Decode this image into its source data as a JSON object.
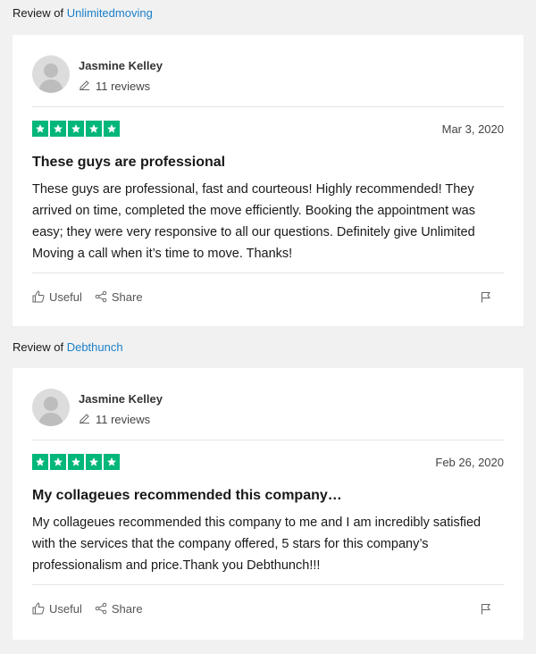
{
  "reviews": [
    {
      "review_of_label": "Review of",
      "company": "Unlimitedmoving",
      "user_name": "Jasmine Kelley",
      "review_count": "11 reviews",
      "rating": 5,
      "date": "Mar 3, 2020",
      "title": "These guys are professional",
      "body": "These guys are professional, fast and courteous! Highly recommended! They arrived on time, completed the move efficiently. Booking the appointment was easy; they were very responsive to all our questions. Definitely give Unlimited Moving a call when it’s time to move. Thanks!",
      "useful_label": "Useful",
      "share_label": "Share"
    },
    {
      "review_of_label": "Review of",
      "company": "Debthunch",
      "user_name": "Jasmine Kelley",
      "review_count": "11 reviews",
      "rating": 5,
      "date": "Feb 26, 2020",
      "title": "My collageues recommended this company…",
      "body": "My collageues recommended this company to me and I am incredibly satisfied with the services that the company offered, 5 stars for this company’s professionalism and price.Thank you Debthunch!!!",
      "useful_label": "Useful",
      "share_label": "Share"
    }
  ],
  "colors": {
    "star_green": "#00b67a",
    "link_blue": "#1c80c8",
    "page_bg": "#f1f1f2"
  },
  "icons": [
    "avatar-placeholder-icon",
    "pen-icon",
    "star-icon",
    "thumbs-up-icon",
    "share-icon",
    "flag-icon"
  ]
}
